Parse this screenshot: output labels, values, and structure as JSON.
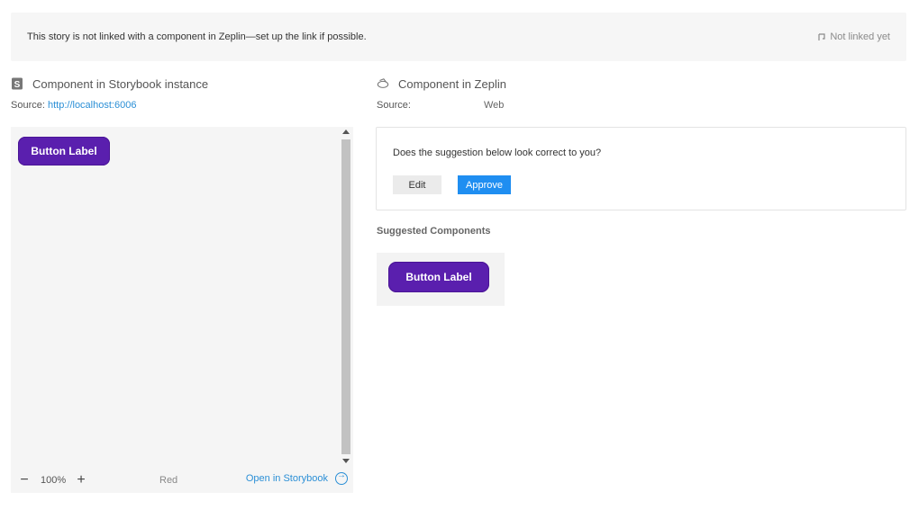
{
  "banner": {
    "message": "This story is not linked with a component in Zeplin—set up the link if possible.",
    "status": "Not linked yet"
  },
  "storybook": {
    "title": "Component in Storybook instance",
    "source_label": "Source:",
    "source_url": "http://localhost:6006",
    "preview_button_label": "Button Label",
    "zoom": "100%",
    "variant": "Red",
    "open_link": "Open in Storybook"
  },
  "zeplin": {
    "title": "Component in Zeplin",
    "source_label": "Source:",
    "source_value": "Web",
    "question": "Does the suggestion below look correct to you?",
    "edit_label": "Edit",
    "approve_label": "Approve",
    "suggested_title": "Suggested Components",
    "suggested_button_label": "Button Label"
  },
  "colors": {
    "accent": "#1f8ef1",
    "link": "#2b8fd6",
    "component_purple": "#5a1fae"
  },
  "icons": {
    "storybook": "storybook-icon",
    "zeplin": "zeplin-icon",
    "status": "unlink-icon",
    "zoom_out": "minus-icon",
    "zoom_in": "plus-icon",
    "open": "arrow-circle-right-icon"
  }
}
